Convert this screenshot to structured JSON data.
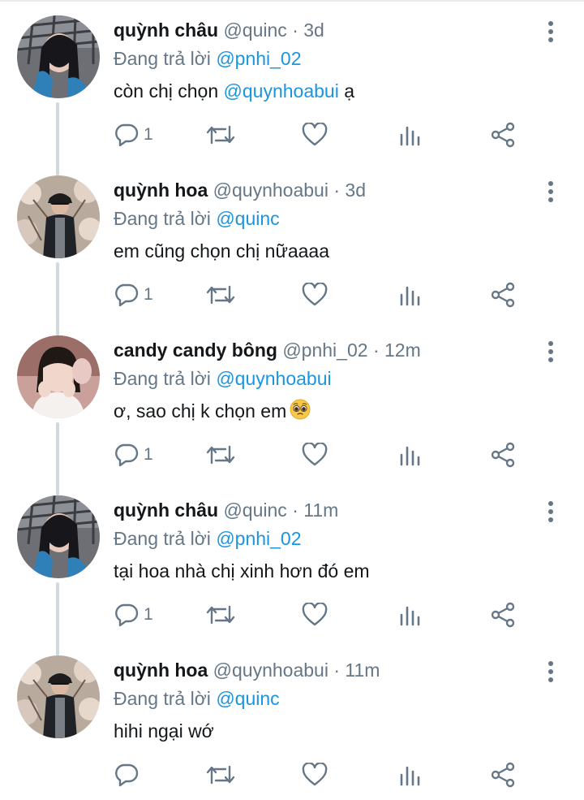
{
  "colors": {
    "text": "#14171a",
    "secondary": "#657786",
    "link": "#1b95e0",
    "thread_line": "#cfd9de"
  },
  "replying_prefix": "Đang trả lời",
  "tweets": [
    {
      "name": "quỳnh châu",
      "handle": "@quinc",
      "time": "· 3d",
      "replying_to": "@pnhi_02",
      "text_before": "còn chị chọn ",
      "text_mention": "@quynhoabui",
      "text_after": " ạ",
      "reply_count": "1",
      "avatar": "quynh-chau-avatar"
    },
    {
      "name": "quỳnh hoa",
      "handle": "@quynhoabui",
      "time": "· 3d",
      "replying_to": "@quinc",
      "text_before": "em cũng chọn chị nữaaaa",
      "text_mention": "",
      "text_after": "",
      "reply_count": "1",
      "avatar": "quynh-hoa-avatar"
    },
    {
      "name": "candy candy bông",
      "handle": "@pnhi_02",
      "time": "· 12m",
      "replying_to": "@quynhoabui",
      "text_before": "ơ, sao chị k chọn em",
      "text_mention": "",
      "text_after": "",
      "emoji": "pleading-face-emoji",
      "reply_count": "1",
      "avatar": "candy-avatar"
    },
    {
      "name": "quỳnh châu",
      "handle": "@quinc",
      "time": "· 11m",
      "replying_to": "@pnhi_02",
      "text_before": "tại hoa nhà chị xinh hơn đó em",
      "text_mention": "",
      "text_after": "",
      "reply_count": "1",
      "avatar": "quynh-chau-avatar"
    },
    {
      "name": "quỳnh hoa",
      "handle": "@quynhoabui",
      "time": "· 11m",
      "replying_to": "@quinc",
      "text_before": "hihi ngại wớ",
      "text_mention": "",
      "text_after": "",
      "reply_count": "",
      "avatar": "quynh-hoa-avatar"
    }
  ],
  "icons": {
    "reply": "reply-icon",
    "retweet": "retweet-icon",
    "like": "like-icon",
    "stats": "stats-icon",
    "share": "share-icon",
    "more": "more-icon"
  }
}
